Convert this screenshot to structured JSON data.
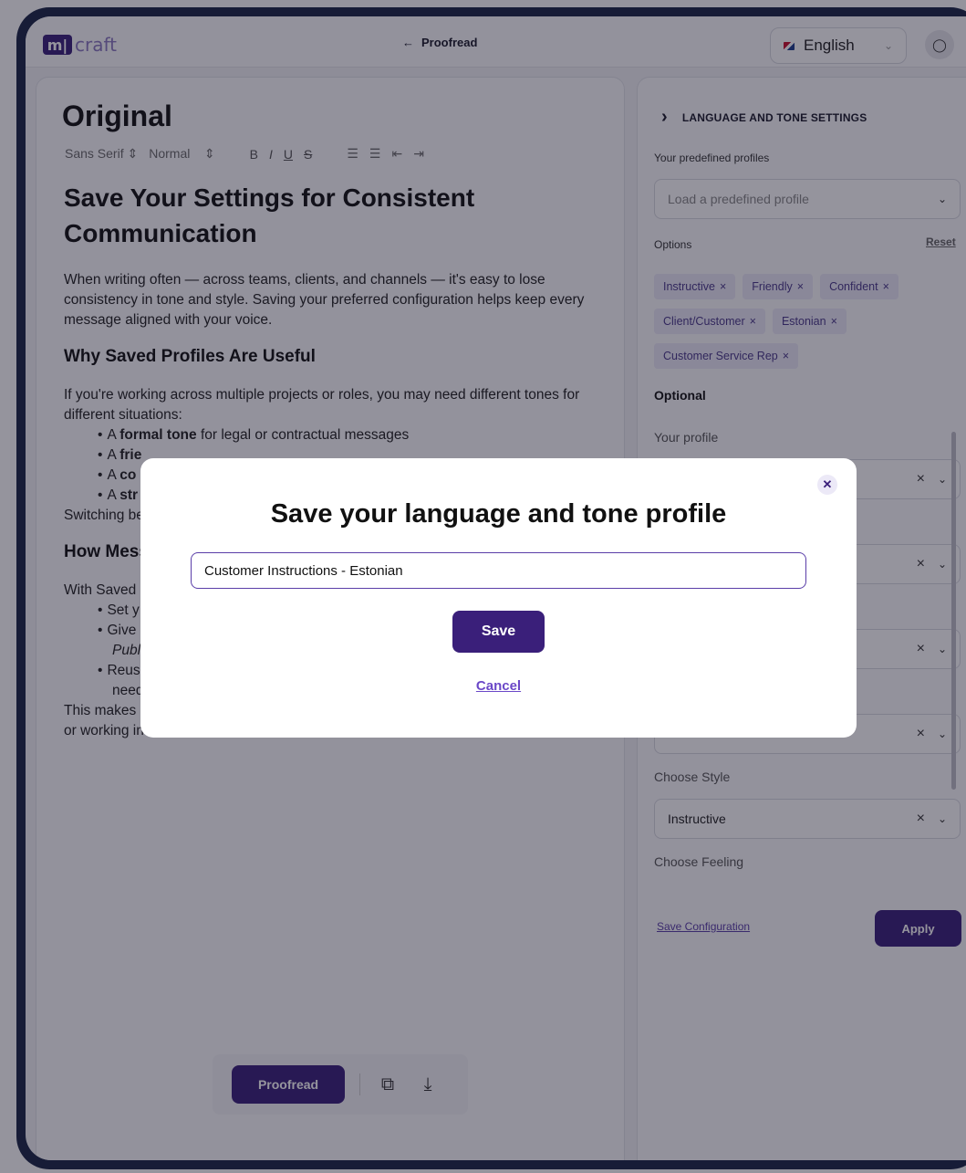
{
  "brand": {
    "logo_mark": "m|",
    "logo_text": "craft"
  },
  "header": {
    "back_label": "Proofread",
    "back_icon": "arrow-left-icon",
    "language": "English",
    "user_icon": "user-icon"
  },
  "editor": {
    "title": "Original",
    "toolbar": {
      "font": "Sans Serif",
      "size": "Normal",
      "bold": "B",
      "italic": "I",
      "underline": "U",
      "strike": "S"
    },
    "doc": {
      "h1": "Save Your Settings for Consistent Communication",
      "p1": "When writing often — across teams, clients, and channels — it's easy to lose consistency in tone and style. Saving your preferred configuration helps keep every message aligned with your voice.",
      "h2a": "Why Saved Profiles Are Useful",
      "p2": "If you're working across multiple projects or roles, you may need different tones for different situations:",
      "bullets1": [
        {
          "pre": "A ",
          "bold": "formal tone",
          "post": " for legal or contractual messages"
        },
        {
          "pre": "A ",
          "bold": "frie",
          "post": ""
        },
        {
          "pre": "A ",
          "bold": "co",
          "post": ""
        },
        {
          "pre": "A ",
          "bold": "str",
          "post": ""
        }
      ],
      "p3": "Switching be",
      "h2b": "How Mess",
      "p4": "With Saved",
      "bullets2": [
        "Set y",
        "Give",
        "Reus"
      ],
      "bullet2_cont_italic": "Publ",
      "bullet3_cont": "neede",
      "p5a": "This makes",
      "p5b": "or working in a team."
    },
    "bottom": {
      "proofread_label": "Proofread",
      "copy_icon": "copy-icon",
      "download_icon": "download-icon"
    }
  },
  "panel": {
    "heading": "LANGUAGE AND TONE SETTINGS",
    "predefined_label": "Your predefined profiles",
    "predefined_placeholder": "Load a predefined profile",
    "options_label": "Options",
    "reset_label": "Reset",
    "chips": [
      "Instructive",
      "Friendly",
      "Confident",
      "Client/Customer",
      "Estonian",
      "Customer Service Rep"
    ],
    "optional_label": "Optional",
    "your_profile_label": "Your profile",
    "choose_style_label": "Choose Style",
    "choose_style_value": "Instructive",
    "choose_feeling_label": "Choose Feeling",
    "save_config_label": "Save Configuration",
    "apply_label": "Apply"
  },
  "modal": {
    "title": "Save your language and tone profile",
    "input_value": "Customer Instructions - Estonian",
    "save_label": "Save",
    "cancel_label": "Cancel",
    "close_icon": "close-icon"
  },
  "colors": {
    "primary": "#3a1f7a",
    "chip_bg": "#ece9f7",
    "link": "#6b48c8"
  }
}
